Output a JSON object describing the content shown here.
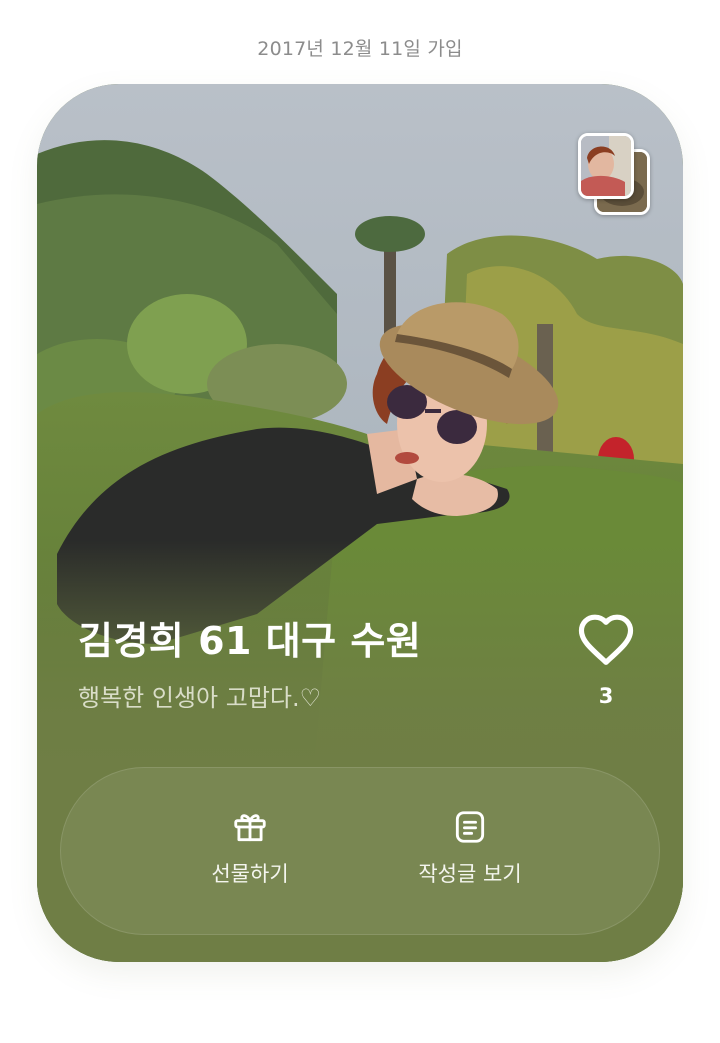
{
  "join_date": "2017년 12월 11일 가입",
  "profile": {
    "name": "김경희 61 대구 수원",
    "status_message": "행복한 인생아 고맙다.♡",
    "like_count": "3"
  },
  "actions": {
    "gift_label": "선물하기",
    "posts_label": "작성글 보기"
  },
  "icons": {
    "like": "heart-icon",
    "gift": "gift-icon",
    "posts": "document-icon"
  },
  "colors": {
    "card_bottom": "#6f7e45",
    "date_text": "#8c8c8c",
    "text_light": "#ffffff"
  }
}
